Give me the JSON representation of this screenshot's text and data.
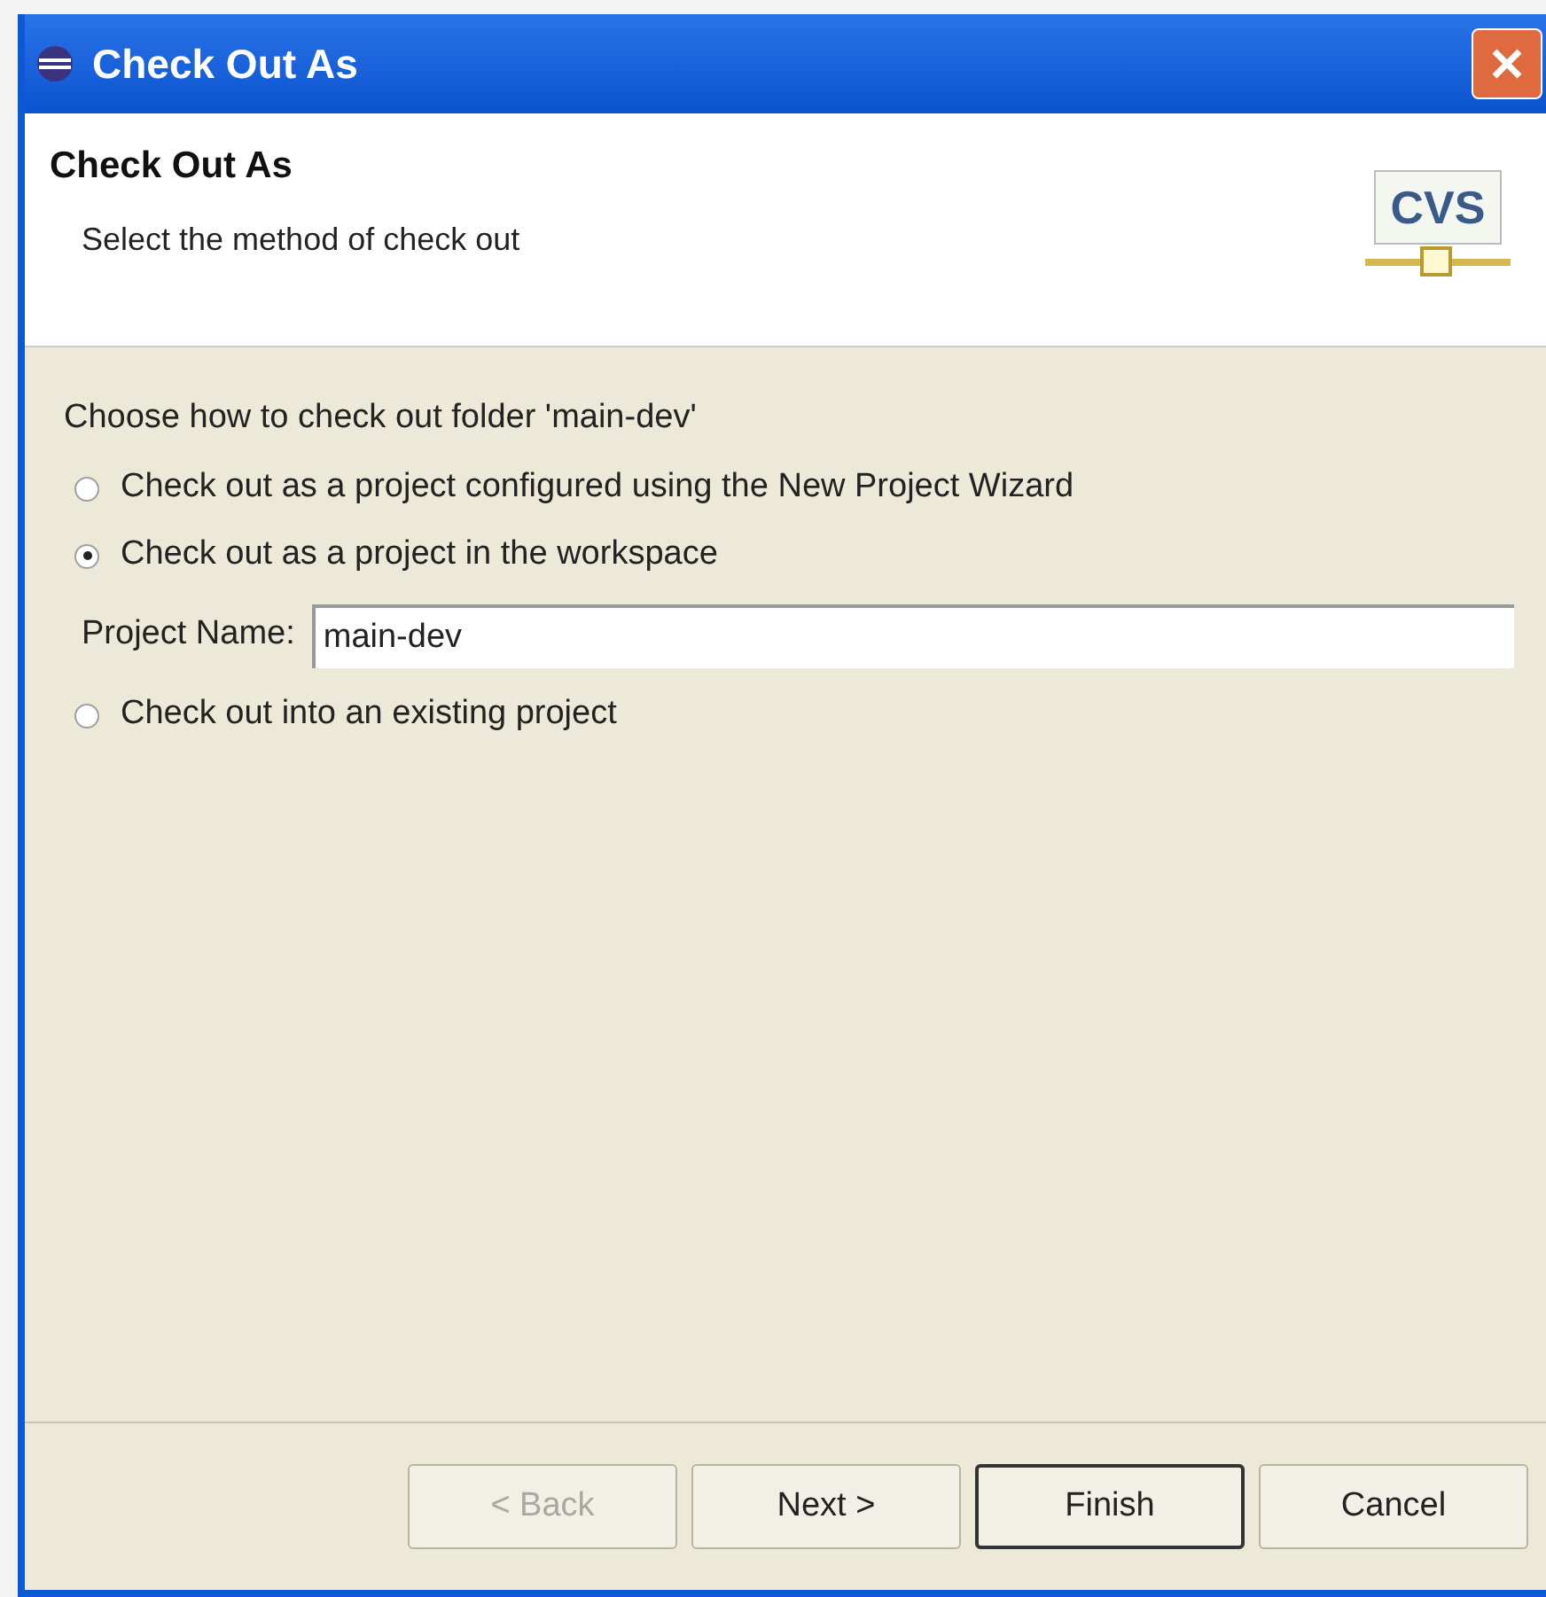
{
  "window": {
    "title": "Check Out As"
  },
  "header": {
    "title": "Check Out As",
    "subtitle": "Select the method of check out",
    "logo_text": "CVS"
  },
  "prompt": "Choose how to check out folder 'main-dev'",
  "options": [
    {
      "kind": "radio",
      "label": "Check out as a project configured using the New Project Wizard",
      "selected": false
    },
    {
      "kind": "radio",
      "label": "Check out as a project in the workspace",
      "selected": true
    },
    {
      "kind": "field",
      "label": "Project Name:",
      "value": "main-dev"
    },
    {
      "kind": "radio",
      "label": "Check out into an existing project",
      "selected": false
    }
  ],
  "buttons": [
    {
      "label": "< Back",
      "disabled": true,
      "default": false
    },
    {
      "label": "Next >",
      "disabled": false,
      "default": false
    },
    {
      "label": "Finish",
      "disabled": false,
      "default": true
    },
    {
      "label": "Cancel",
      "disabled": false,
      "default": false
    }
  ]
}
